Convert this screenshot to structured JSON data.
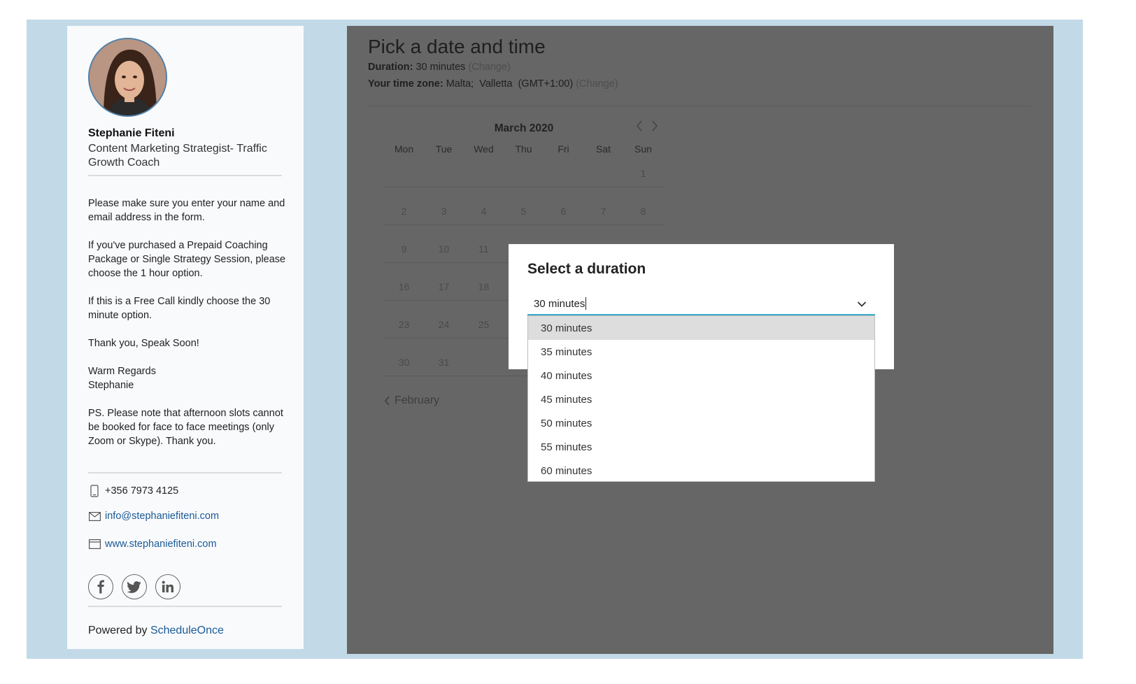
{
  "host": {
    "name": "Stephanie Fiteni",
    "title": "Content Marketing Strategist- Traffic Growth Coach",
    "notes": [
      "Please make sure you enter your name and email address in the form.",
      "If you've purchased a Prepaid Coaching Package or Single Strategy Session, please choose the 1 hour option.",
      "If this is a Free Call kindly choose the 30 minute option.",
      "Thank you, Speak Soon!",
      "Warm Regards\nStephanie",
      "PS. Please note that afternoon slots cannot be booked for face to face meetings (only Zoom or Skype). Thank you."
    ],
    "phone": "+356 7973 4125",
    "email": "info@stephaniefiteni.com",
    "website": "www.stephaniefiteni.com",
    "social": {
      "facebook": "f",
      "twitter": "t",
      "linkedin": "in"
    },
    "powered_prefix": "Powered by",
    "powered_brand": "ScheduleOnce"
  },
  "main": {
    "heading": "Pick a date and time",
    "duration_label": "Duration:",
    "duration_value": "30 minutes",
    "duration_change": "(Change)",
    "timezone_label": "Your time zone:",
    "timezone_value": "Malta;  Valletta  (GMT+1:00)",
    "timezone_change": "(Change)"
  },
  "calendar": {
    "month": "March 2020",
    "weekdays": [
      "Mon",
      "Tue",
      "Wed",
      "Thu",
      "Fri",
      "Sat",
      "Sun"
    ],
    "weeks": [
      [
        "",
        "",
        "",
        "",
        "",
        "",
        "1"
      ],
      [
        "2",
        "3",
        "4",
        "5",
        "6",
        "7",
        "8"
      ],
      [
        "9",
        "10",
        "11",
        "",
        "",
        "",
        ""
      ],
      [
        "16",
        "17",
        "18",
        "",
        "",
        "",
        ""
      ],
      [
        "23",
        "24",
        "25",
        "",
        "",
        "",
        ""
      ],
      [
        "30",
        "31",
        "",
        "",
        "",
        "",
        ""
      ]
    ],
    "prev_label": "February"
  },
  "modal": {
    "title": "Select a duration",
    "selected": "30 minutes",
    "options": [
      "30 minutes",
      "35 minutes",
      "40 minutes",
      "45 minutes",
      "50 minutes",
      "55 minutes",
      "60 minutes"
    ],
    "highlighted_index": 0,
    "accent_color": "#3aa8c8"
  },
  "icons": [
    "phone-icon",
    "mail-icon",
    "browser-icon",
    "facebook-icon",
    "twitter-icon",
    "linkedin-icon",
    "chevron-left-icon",
    "chevron-right-icon",
    "chevron-down-icon"
  ]
}
